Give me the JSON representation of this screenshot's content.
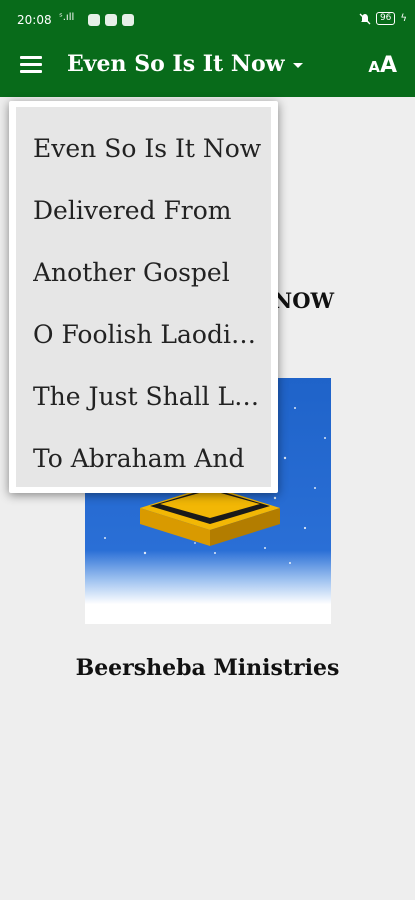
{
  "status_bar": {
    "time": "20:08",
    "signal": "ˢ.ıll",
    "battery": "96"
  },
  "app_bar": {
    "title": "Even So Is It Now",
    "font_size_small": "A",
    "font_size_large": "A"
  },
  "content": {
    "heading_visible": "NOW",
    "ministry": "Beersheba Ministries"
  },
  "dropdown": {
    "items": [
      "Even So Is It Now",
      "Delivered From",
      "Another Gospel",
      "O Foolish Laodiceans",
      "The Just Shall Live",
      "To Abraham And"
    ]
  },
  "colors": {
    "app_bar": "#086b1a",
    "background": "#eeeeee",
    "menu_surface": "#e6e6e6"
  },
  "icons": [
    "hamburger-menu-icon",
    "dropdown-caret-icon",
    "font-size-icon",
    "mute-icon",
    "battery-icon"
  ]
}
